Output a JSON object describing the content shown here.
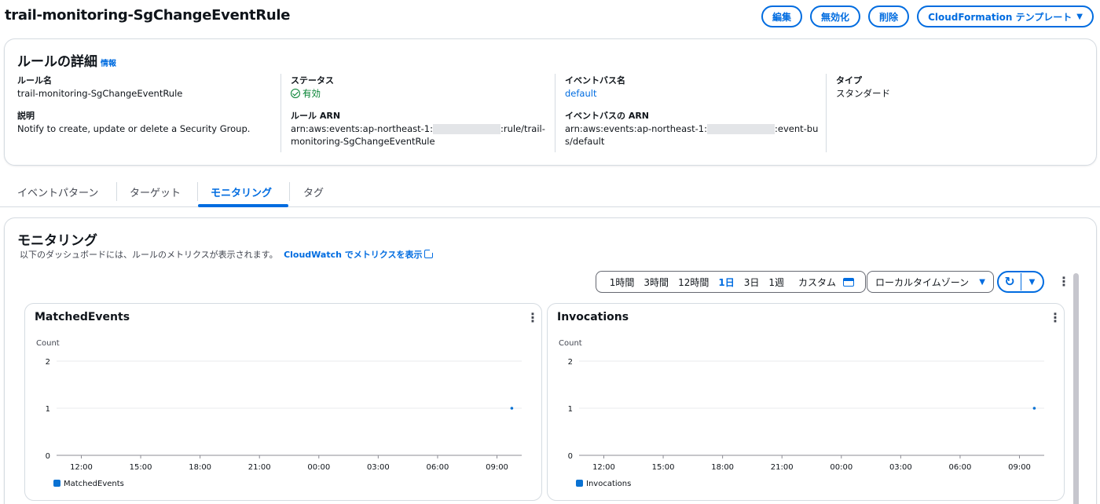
{
  "header": {
    "title": "trail-monitoring-SgChangeEventRule",
    "buttons": {
      "edit": "編集",
      "disable": "無効化",
      "delete": "削除",
      "cloudformation": "CloudFormation テンプレート"
    }
  },
  "details": {
    "title": "ルールの詳細",
    "info": "情報",
    "rule_name_label": "ルール名",
    "rule_name": "trail-monitoring-SgChangeEventRule",
    "description_label": "説明",
    "description": "Notify to create, update or delete a Security Group.",
    "status_label": "ステータス",
    "status": "有効",
    "rule_arn_label": "ルール ARN",
    "rule_arn_prefix": "arn:aws:events:ap-northeast-1:",
    "rule_arn_suffix": ":rule/trail-",
    "rule_arn_line2": "monitoring-SgChangeEventRule",
    "bus_name_label": "イベントバス名",
    "bus_name": "default",
    "bus_arn_label": "イベントバスの ARN",
    "bus_arn_prefix": "arn:aws:events:ap-northeast-1:",
    "bus_arn_suffix": ":event-bu",
    "bus_arn_line2": "s/default",
    "type_label": "タイプ",
    "type": "スタンダード"
  },
  "tabs": [
    "イベントパターン",
    "ターゲット",
    "モニタリング",
    "タグ"
  ],
  "active_tab": "モニタリング",
  "monitoring": {
    "title": "モニタリング",
    "subtitle": "以下のダッシュボードには、ルールのメトリクスが表示されます。",
    "cw_link": "CloudWatch でメトリクスを表示",
    "ranges": [
      "1時間",
      "3時間",
      "12時間",
      "1日",
      "3日",
      "1週"
    ],
    "selected_range": "1日",
    "custom": "カスタム",
    "timezone": "ローカルタイムゾーン"
  },
  "colors": {
    "accent": "#006ce0",
    "success": "#00802f",
    "series": "#0972d3"
  },
  "chart_data": [
    {
      "type": "line",
      "title": "MatchedEvents",
      "ylabel": "Count",
      "ylim": [
        0,
        2
      ],
      "yticks": [
        0,
        1,
        2
      ],
      "xticks": [
        "12:00",
        "15:00",
        "18:00",
        "21:00",
        "00:00",
        "03:00",
        "06:00",
        "09:00"
      ],
      "series": [
        {
          "name": "MatchedEvents",
          "points": [
            {
              "x": "09:45",
              "y": 1
            }
          ]
        }
      ]
    },
    {
      "type": "line",
      "title": "Invocations",
      "ylabel": "Count",
      "ylim": [
        0,
        2
      ],
      "yticks": [
        0,
        1,
        2
      ],
      "xticks": [
        "12:00",
        "15:00",
        "18:00",
        "21:00",
        "00:00",
        "03:00",
        "06:00",
        "09:00"
      ],
      "series": [
        {
          "name": "Invocations",
          "points": [
            {
              "x": "09:45",
              "y": 1
            }
          ]
        }
      ]
    }
  ]
}
